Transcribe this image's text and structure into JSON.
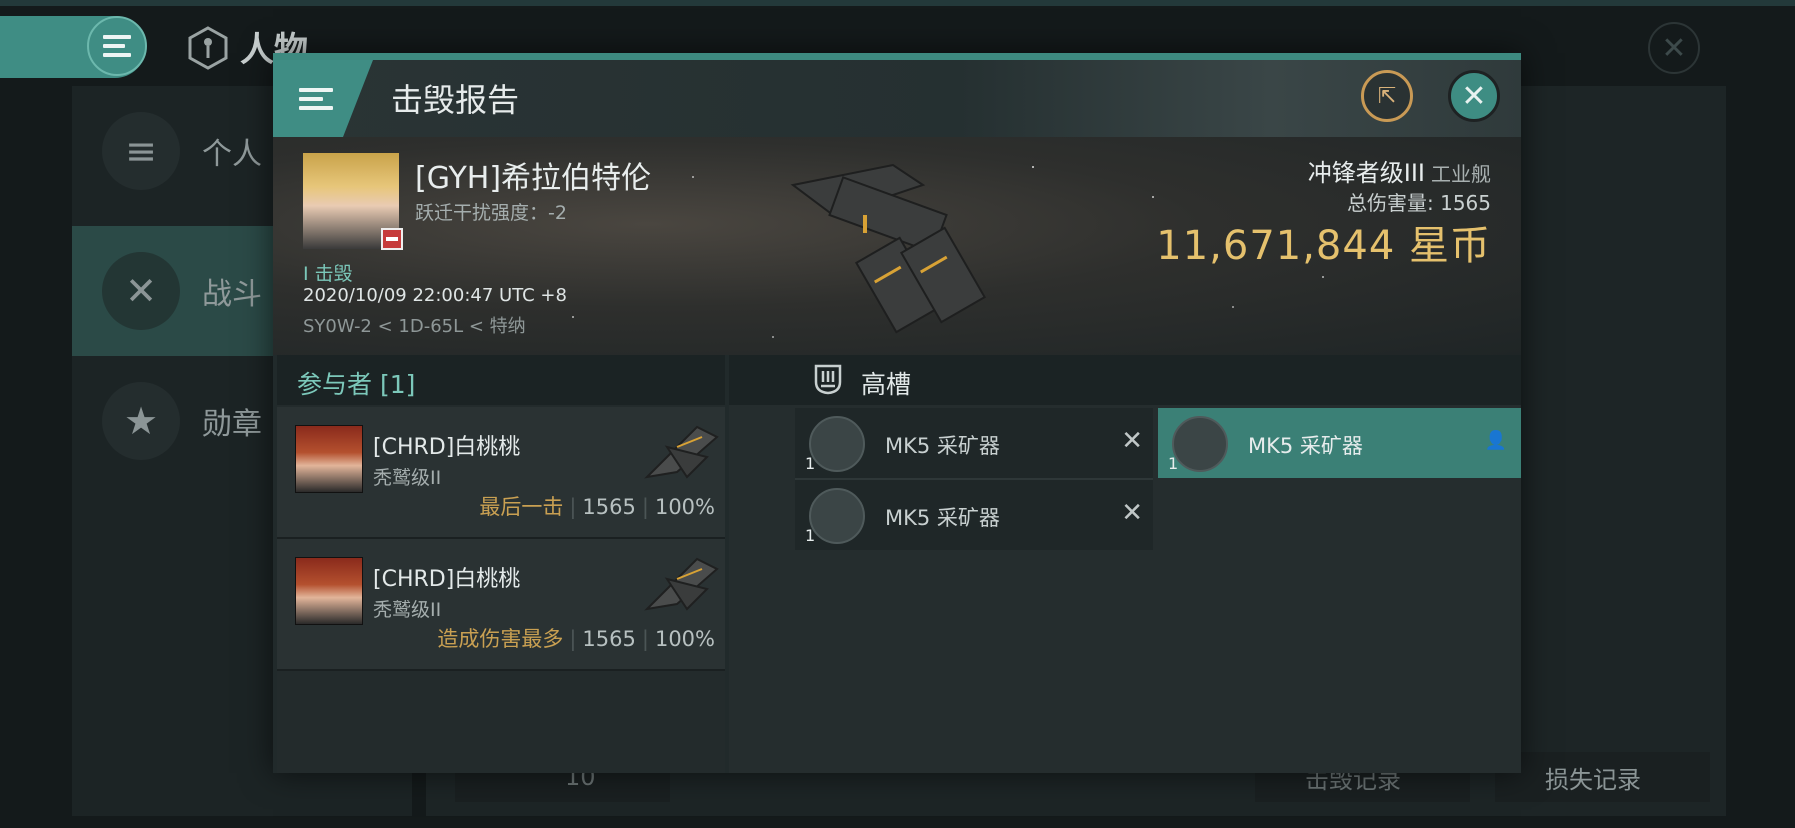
{
  "background": {
    "title": "人物",
    "sidebar": [
      {
        "label": "个人",
        "icon": "list-icon"
      },
      {
        "label": "战斗",
        "icon": "crossed-swords-icon",
        "active": true
      },
      {
        "label": "勋章",
        "icon": "star-badge-icon"
      }
    ],
    "bottom_count": "10",
    "kill_log_label": "击毁记录",
    "loss_log_label": "损失记录"
  },
  "dialog": {
    "title": "击毁报告",
    "victim": {
      "name": "[GYH]希拉伯特伦",
      "warp_disrupt": "跃迁干扰强度：-2",
      "kill_count": "I 击毁",
      "time": "2020/10/09 22:00:47 UTC +8",
      "location": "SY0W-2 < 1D-65L < 特纳"
    },
    "ship": {
      "name": "冲锋者级III",
      "class": "工业舰",
      "total_damage": "总伤害量: 1565",
      "value": "11,671,844 星币"
    },
    "participants": {
      "title": "参与者 [1]",
      "rows": [
        {
          "name": "[CHRD]白桃桃",
          "ship": "秃鹫级II",
          "tag": "最后一击",
          "damage": "1565",
          "percent": "100%"
        },
        {
          "name": "[CHRD]白桃桃",
          "ship": "秃鹫级II",
          "tag": "造成伤害最多",
          "damage": "1565",
          "percent": "100%"
        }
      ]
    },
    "modules": {
      "title": "高槽",
      "items": [
        {
          "name": "MK5 采矿器",
          "qty": "1",
          "state": "destroyed"
        },
        {
          "name": "MK5 采矿器",
          "qty": "1",
          "state": "dropped"
        },
        {
          "name": "MK5 采矿器",
          "qty": "1",
          "state": "destroyed"
        }
      ]
    }
  },
  "colors": {
    "accent": "#3f8d84",
    "isk": "#e5c16d",
    "tag": "#c9a052",
    "danger": "#c63a3a"
  }
}
